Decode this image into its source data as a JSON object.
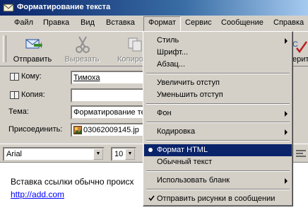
{
  "window": {
    "title": "Форматирование текста"
  },
  "menubar": [
    "Файл",
    "Правка",
    "Вид",
    "Вставка",
    "Формат",
    "Сервис",
    "Сообщение",
    "Справка"
  ],
  "toolbar": {
    "send": "Отправить",
    "cut": "Вырезать",
    "copy_partial": "Копиро",
    "last_partial": "ерить"
  },
  "header": {
    "to_label": "Кому:",
    "to_value": "Тимоха",
    "cc_label": "Копия:",
    "subject_label": "Тема:",
    "subject_value": "Форматирование те",
    "attach_label": "Присоединить:",
    "attach_value": "03062009145.jp"
  },
  "format_bar": {
    "font": "Arial",
    "size": "10"
  },
  "body": {
    "text": "Вставка ссылки обычно происх",
    "link": "http://add.com"
  },
  "format_menu": {
    "style": "Стиль",
    "font": "Шрифт...",
    "paragraph": "Абзац...",
    "indent_inc": "Увеличить отступ",
    "indent_dec": "Уменьшить отступ",
    "background": "Фон",
    "encoding": "Кодировка",
    "html": "Формат HTML",
    "plain": "Обычный текст",
    "template": "Использовать бланк",
    "send_pics": "Отправить рисунки в сообщении"
  },
  "colors": {
    "highlight": "#0a246a",
    "link": "#0000ff",
    "chrome": "#d4d0c8"
  }
}
